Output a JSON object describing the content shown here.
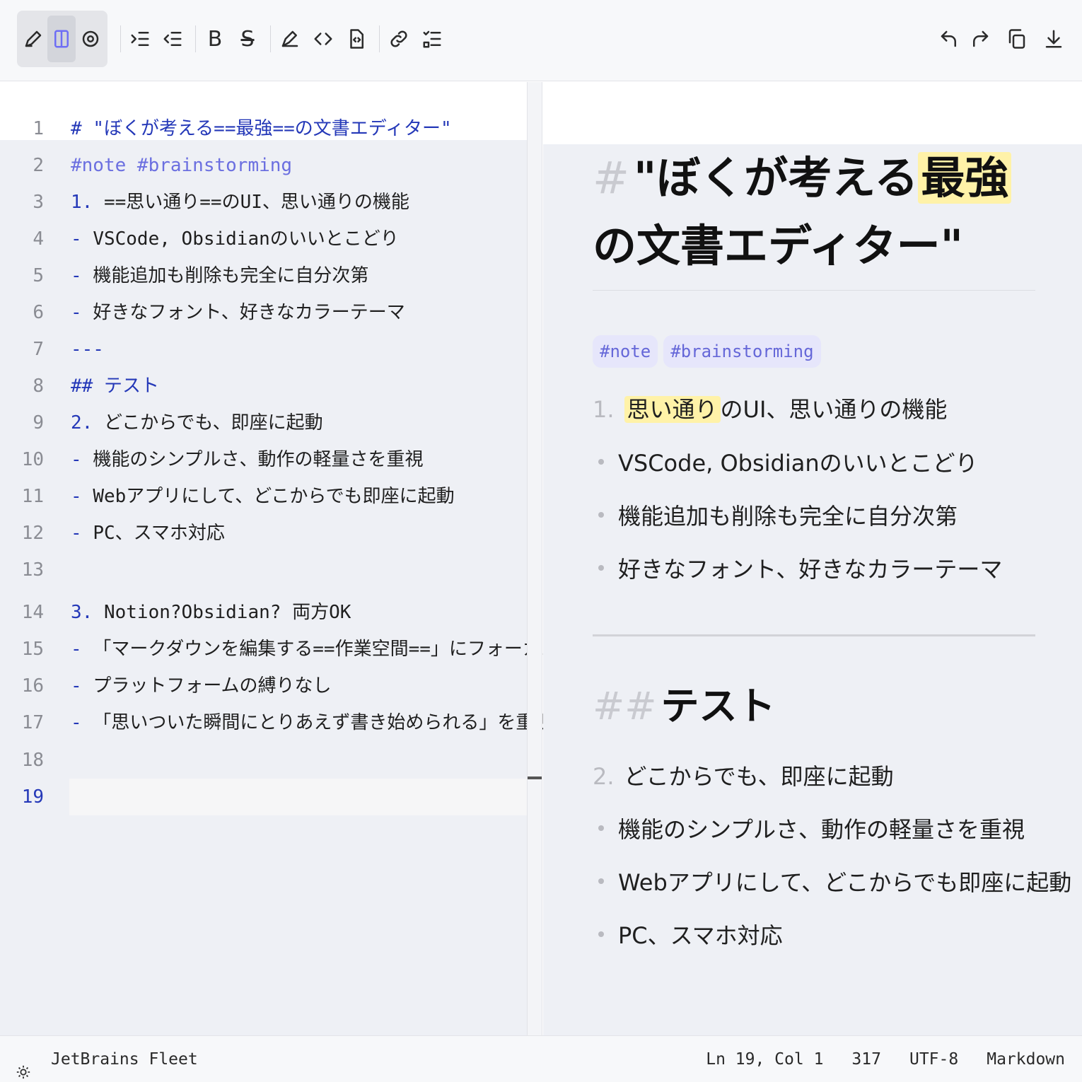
{
  "toolbar": {
    "icons": [
      "edit-icon",
      "split-view-icon",
      "preview-icon",
      "indent-icon",
      "outdent-icon",
      "bold-icon",
      "strikethrough-icon",
      "highlight-icon",
      "code-icon",
      "file-code-icon",
      "link-icon",
      "checklist-icon",
      "undo-icon",
      "redo-icon",
      "copy-icon",
      "download-icon"
    ],
    "bold_label": "B",
    "strike_label": "S"
  },
  "editor": {
    "lines": [
      {
        "num": "1",
        "mark": "# ",
        "text": "\"ぼくが考える==最強==の文書エディター\""
      },
      {
        "num": "2",
        "mark": "",
        "text": "#note #brainstorming"
      },
      {
        "num": "3",
        "mark": "1. ",
        "text": "==思い通り==のUI、思い通りの機能"
      },
      {
        "num": "4",
        "mark": "- ",
        "text": "VSCode, Obsidianのいいとこどり"
      },
      {
        "num": "5",
        "mark": "- ",
        "text": "機能追加も削除も完全に自分次第"
      },
      {
        "num": "6",
        "mark": "- ",
        "text": "好きなフォント、好きなカラーテーマ"
      },
      {
        "num": "7",
        "mark": "---",
        "text": ""
      },
      {
        "num": "8",
        "mark": "## ",
        "text": "テスト"
      },
      {
        "num": "9",
        "mark": "2. ",
        "text": "どこからでも、即座に起動"
      },
      {
        "num": "10",
        "mark": "- ",
        "text": "機能のシンプルさ、動作の軽量さを重視"
      },
      {
        "num": "11",
        "mark": "- ",
        "text": "Webアプリにして、どこからでも即座に起動"
      },
      {
        "num": "12",
        "mark": "- ",
        "text": "PC、スマホ対応"
      },
      {
        "num": "13",
        "mark": "",
        "text": ""
      },
      {
        "num": "14",
        "mark": "3. ",
        "text": "Notion?Obsidian? 両方OK"
      },
      {
        "num": "15",
        "mark": "- ",
        "text": "「マークダウンを編集する==作業空間==」にフォーカス"
      },
      {
        "num": "16",
        "mark": "- ",
        "text": "プラットフォームの縛りなし"
      },
      {
        "num": "17",
        "mark": "- ",
        "text": "「思いついた瞬間にとりあえず書き始められる」を重視"
      },
      {
        "num": "18",
        "mark": "",
        "text": ""
      },
      {
        "num": "19",
        "mark": "",
        "text": ""
      }
    ]
  },
  "preview": {
    "h1_mark": "#",
    "h1_pre": "\"ぼくが考える",
    "h1_hl": "最強",
    "h1_post": "の文書エディター\"",
    "tags": [
      "#note",
      "#brainstorming"
    ],
    "list1_num": "1.",
    "list1_hl": "思い通り",
    "list1_post": "のUI、思い通りの機能",
    "bullets1": [
      "VSCode, Obsidianのいいとこどり",
      "機能追加も削除も完全に自分次第",
      "好きなフォント、好きなカラーテーマ"
    ],
    "h2_mark": "##",
    "h2_text": "テスト",
    "list2_num": "2.",
    "list2_text": "どこからでも、即座に起動",
    "bullets2": [
      "機能のシンプルさ、動作の軽量さを重視",
      "Webアプリにして、どこからでも即座に起動",
      "PC、スマホ対応"
    ]
  },
  "status": {
    "app_name": "JetBrains Fleet",
    "cursor": "Ln 19, Col 1",
    "chars": "317",
    "encoding": "UTF-8",
    "language": "Markdown"
  }
}
